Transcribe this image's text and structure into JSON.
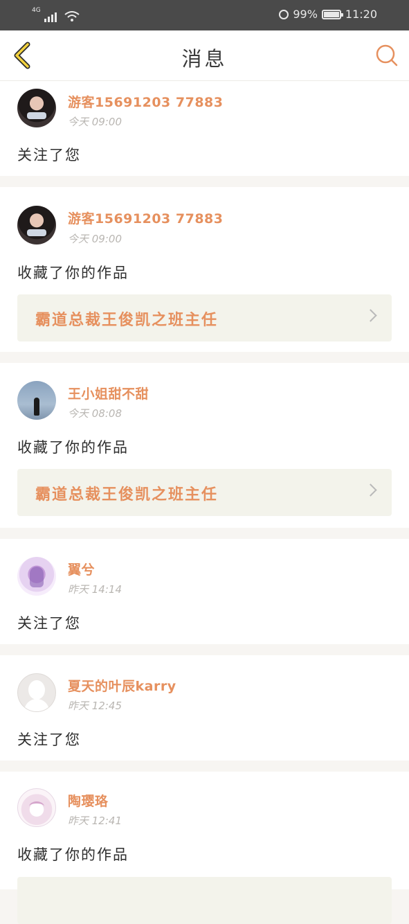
{
  "status_bar": {
    "network": "4G",
    "battery_percent": "99%",
    "time": "11:20",
    "icons": [
      "signal-icon",
      "wifi-icon",
      "alarm-icon",
      "battery-icon"
    ]
  },
  "header": {
    "title": "消息",
    "back_icon": "chevron-left-icon",
    "search_icon": "search-icon",
    "accent_color": "#e6905e"
  },
  "messages": [
    {
      "username": "游客15691203 77883",
      "time": "今天 09:00",
      "action": "关注了您",
      "avatar": "portrait"
    },
    {
      "username": "游客15691203 77883",
      "time": "今天 09:00",
      "action": "收藏了你的作品",
      "work_title": "霸道总裁王俊凯之班主任",
      "avatar": "portrait"
    },
    {
      "username": "王小姐甜不甜",
      "time": "今天 08:08",
      "action": "收藏了你的作品",
      "work_title": "霸道总裁王俊凯之班主任",
      "avatar": "sky"
    },
    {
      "username": "翼兮",
      "time": "昨天 14:14",
      "action": "关注了您",
      "avatar": "purple"
    },
    {
      "username": "夏天的叶辰karry",
      "time": "昨天 12:45",
      "action": "关注了您",
      "avatar": "default"
    },
    {
      "username": "陶璎珞",
      "time": "昨天 12:41",
      "action": "收藏了你的作品",
      "avatar": "anime"
    }
  ]
}
